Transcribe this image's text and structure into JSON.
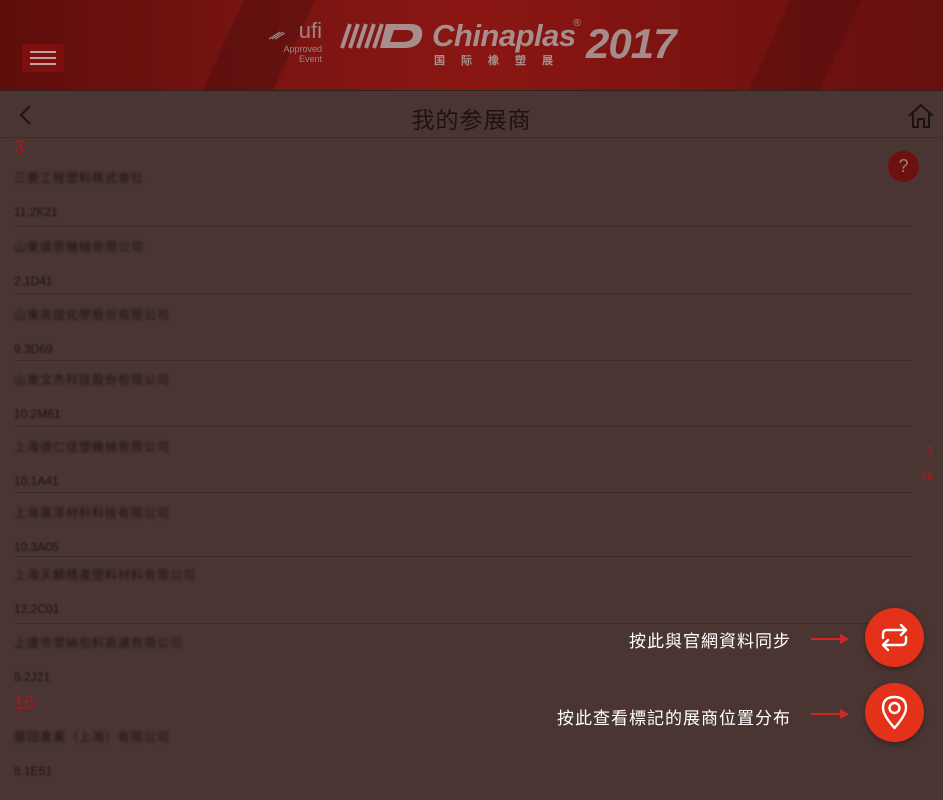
{
  "header": {
    "ufi": {
      "mark": "ufi",
      "sub_line1": "Approved",
      "sub_line2": "Event"
    },
    "brand": {
      "name": "Chinaplas",
      "reg": "®",
      "year": "2017",
      "chinese": "国际橡塑展"
    }
  },
  "nav": {
    "title": "我的参展商"
  },
  "help_label": "?",
  "groups": [
    {
      "letter": "3",
      "items": [
        {
          "name": "三菱工程塑料株式會社",
          "booth": "11.2K21"
        },
        {
          "name": "山東道恩機械有限公司",
          "booth": "2.1D41"
        },
        {
          "name": "山東高誼化學股份有限公司",
          "booth": "9.3D69"
        },
        {
          "name": "山東文杰科技股份有限公司",
          "booth": "10.2M61"
        },
        {
          "name": "上海德仁佳塑機械有限公司",
          "booth": "10.1A41"
        },
        {
          "name": "上海嘉洋材料科技有限公司",
          "booth": "10.3A05"
        },
        {
          "name": "上海天麟精產塑料材料有限公司",
          "booth": "12.2C01"
        },
        {
          "name": "上虞市眾納包料高速有限公司",
          "booth": "5.2J21"
        }
      ]
    },
    {
      "letter": "16",
      "items": [
        {
          "name": "藤田產業（上海）有限公司",
          "booth": "8.1E51"
        }
      ]
    }
  ],
  "index": [
    "3",
    "16"
  ],
  "hints": {
    "sync": "按此與官網資料同步",
    "map": "按此查看標記的展商位置分布"
  },
  "icons": {
    "menu": "hamburger-menu-icon",
    "back": "chevron-left-icon",
    "home": "home-icon",
    "sync": "sync-icon",
    "location": "location-pin-icon"
  },
  "colors": {
    "banner": "#7a1512",
    "accent": "#a8181c",
    "fab": "#e3311a",
    "overlay_bg": "#4a3532"
  }
}
